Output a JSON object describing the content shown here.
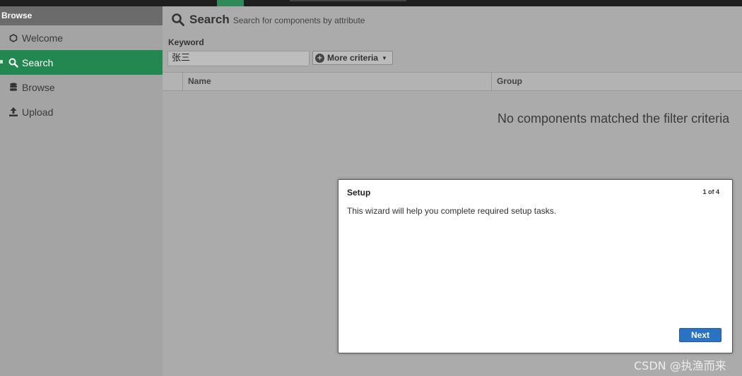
{
  "topbar": {
    "crumb": ""
  },
  "sidebar": {
    "header": "Browse",
    "items": [
      {
        "label": "Welcome",
        "icon": "hexagon-icon"
      },
      {
        "label": "Search",
        "icon": "search-icon",
        "active": true
      },
      {
        "label": "Browse",
        "icon": "database-icon"
      },
      {
        "label": "Upload",
        "icon": "upload-icon"
      }
    ]
  },
  "main": {
    "title": "Search",
    "subtitle": "Search for components by attribute",
    "keyword_label": "Keyword",
    "keyword_value": "张三",
    "more_criteria_label": "More criteria",
    "columns": [
      "Name",
      "Group"
    ],
    "empty_message": "No components matched the filter criteria"
  },
  "modal": {
    "title": "Setup",
    "step": "1 of 4",
    "body": "This wizard will help you complete required setup tasks.",
    "next_label": "Next"
  },
  "watermark": "CSDN @执渔而来",
  "colors": {
    "accent_green": "#23884f",
    "primary_blue": "#2a72c4",
    "sidebar_bg": "#a4a4a4"
  }
}
